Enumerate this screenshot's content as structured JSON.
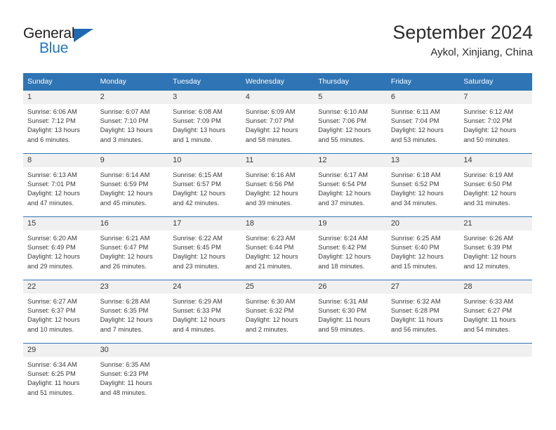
{
  "brand": {
    "name_part1": "General",
    "name_part2": "Blue",
    "flag_icon": "triangle-flag-icon"
  },
  "header": {
    "title": "September 2024",
    "subtitle": "Aykol, Xinjiang, China"
  },
  "calendar": {
    "weekday_headers": [
      "Sunday",
      "Monday",
      "Tuesday",
      "Wednesday",
      "Thursday",
      "Friday",
      "Saturday"
    ],
    "header_bg": "#2f75b5",
    "daynum_bg": "#f0f0f0",
    "weeks": [
      [
        {
          "day": "1",
          "sunrise": "Sunrise: 6:06 AM",
          "sunset": "Sunset: 7:12 PM",
          "daylight_line1": "Daylight: 13 hours",
          "daylight_line2": "and 6 minutes."
        },
        {
          "day": "2",
          "sunrise": "Sunrise: 6:07 AM",
          "sunset": "Sunset: 7:10 PM",
          "daylight_line1": "Daylight: 13 hours",
          "daylight_line2": "and 3 minutes."
        },
        {
          "day": "3",
          "sunrise": "Sunrise: 6:08 AM",
          "sunset": "Sunset: 7:09 PM",
          "daylight_line1": "Daylight: 13 hours",
          "daylight_line2": "and 1 minute."
        },
        {
          "day": "4",
          "sunrise": "Sunrise: 6:09 AM",
          "sunset": "Sunset: 7:07 PM",
          "daylight_line1": "Daylight: 12 hours",
          "daylight_line2": "and 58 minutes."
        },
        {
          "day": "5",
          "sunrise": "Sunrise: 6:10 AM",
          "sunset": "Sunset: 7:06 PM",
          "daylight_line1": "Daylight: 12 hours",
          "daylight_line2": "and 55 minutes."
        },
        {
          "day": "6",
          "sunrise": "Sunrise: 6:11 AM",
          "sunset": "Sunset: 7:04 PM",
          "daylight_line1": "Daylight: 12 hours",
          "daylight_line2": "and 53 minutes."
        },
        {
          "day": "7",
          "sunrise": "Sunrise: 6:12 AM",
          "sunset": "Sunset: 7:02 PM",
          "daylight_line1": "Daylight: 12 hours",
          "daylight_line2": "and 50 minutes."
        }
      ],
      [
        {
          "day": "8",
          "sunrise": "Sunrise: 6:13 AM",
          "sunset": "Sunset: 7:01 PM",
          "daylight_line1": "Daylight: 12 hours",
          "daylight_line2": "and 47 minutes."
        },
        {
          "day": "9",
          "sunrise": "Sunrise: 6:14 AM",
          "sunset": "Sunset: 6:59 PM",
          "daylight_line1": "Daylight: 12 hours",
          "daylight_line2": "and 45 minutes."
        },
        {
          "day": "10",
          "sunrise": "Sunrise: 6:15 AM",
          "sunset": "Sunset: 6:57 PM",
          "daylight_line1": "Daylight: 12 hours",
          "daylight_line2": "and 42 minutes."
        },
        {
          "day": "11",
          "sunrise": "Sunrise: 6:16 AM",
          "sunset": "Sunset: 6:56 PM",
          "daylight_line1": "Daylight: 12 hours",
          "daylight_line2": "and 39 minutes."
        },
        {
          "day": "12",
          "sunrise": "Sunrise: 6:17 AM",
          "sunset": "Sunset: 6:54 PM",
          "daylight_line1": "Daylight: 12 hours",
          "daylight_line2": "and 37 minutes."
        },
        {
          "day": "13",
          "sunrise": "Sunrise: 6:18 AM",
          "sunset": "Sunset: 6:52 PM",
          "daylight_line1": "Daylight: 12 hours",
          "daylight_line2": "and 34 minutes."
        },
        {
          "day": "14",
          "sunrise": "Sunrise: 6:19 AM",
          "sunset": "Sunset: 6:50 PM",
          "daylight_line1": "Daylight: 12 hours",
          "daylight_line2": "and 31 minutes."
        }
      ],
      [
        {
          "day": "15",
          "sunrise": "Sunrise: 6:20 AM",
          "sunset": "Sunset: 6:49 PM",
          "daylight_line1": "Daylight: 12 hours",
          "daylight_line2": "and 29 minutes."
        },
        {
          "day": "16",
          "sunrise": "Sunrise: 6:21 AM",
          "sunset": "Sunset: 6:47 PM",
          "daylight_line1": "Daylight: 12 hours",
          "daylight_line2": "and 26 minutes."
        },
        {
          "day": "17",
          "sunrise": "Sunrise: 6:22 AM",
          "sunset": "Sunset: 6:45 PM",
          "daylight_line1": "Daylight: 12 hours",
          "daylight_line2": "and 23 minutes."
        },
        {
          "day": "18",
          "sunrise": "Sunrise: 6:23 AM",
          "sunset": "Sunset: 6:44 PM",
          "daylight_line1": "Daylight: 12 hours",
          "daylight_line2": "and 21 minutes."
        },
        {
          "day": "19",
          "sunrise": "Sunrise: 6:24 AM",
          "sunset": "Sunset: 6:42 PM",
          "daylight_line1": "Daylight: 12 hours",
          "daylight_line2": "and 18 minutes."
        },
        {
          "day": "20",
          "sunrise": "Sunrise: 6:25 AM",
          "sunset": "Sunset: 6:40 PM",
          "daylight_line1": "Daylight: 12 hours",
          "daylight_line2": "and 15 minutes."
        },
        {
          "day": "21",
          "sunrise": "Sunrise: 6:26 AM",
          "sunset": "Sunset: 6:39 PM",
          "daylight_line1": "Daylight: 12 hours",
          "daylight_line2": "and 12 minutes."
        }
      ],
      [
        {
          "day": "22",
          "sunrise": "Sunrise: 6:27 AM",
          "sunset": "Sunset: 6:37 PM",
          "daylight_line1": "Daylight: 12 hours",
          "daylight_line2": "and 10 minutes."
        },
        {
          "day": "23",
          "sunrise": "Sunrise: 6:28 AM",
          "sunset": "Sunset: 6:35 PM",
          "daylight_line1": "Daylight: 12 hours",
          "daylight_line2": "and 7 minutes."
        },
        {
          "day": "24",
          "sunrise": "Sunrise: 6:29 AM",
          "sunset": "Sunset: 6:33 PM",
          "daylight_line1": "Daylight: 12 hours",
          "daylight_line2": "and 4 minutes."
        },
        {
          "day": "25",
          "sunrise": "Sunrise: 6:30 AM",
          "sunset": "Sunset: 6:32 PM",
          "daylight_line1": "Daylight: 12 hours",
          "daylight_line2": "and 2 minutes."
        },
        {
          "day": "26",
          "sunrise": "Sunrise: 6:31 AM",
          "sunset": "Sunset: 6:30 PM",
          "daylight_line1": "Daylight: 11 hours",
          "daylight_line2": "and 59 minutes."
        },
        {
          "day": "27",
          "sunrise": "Sunrise: 6:32 AM",
          "sunset": "Sunset: 6:28 PM",
          "daylight_line1": "Daylight: 11 hours",
          "daylight_line2": "and 56 minutes."
        },
        {
          "day": "28",
          "sunrise": "Sunrise: 6:33 AM",
          "sunset": "Sunset: 6:27 PM",
          "daylight_line1": "Daylight: 11 hours",
          "daylight_line2": "and 54 minutes."
        }
      ],
      [
        {
          "day": "29",
          "sunrise": "Sunrise: 6:34 AM",
          "sunset": "Sunset: 6:25 PM",
          "daylight_line1": "Daylight: 11 hours",
          "daylight_line2": "and 51 minutes."
        },
        {
          "day": "30",
          "sunrise": "Sunrise: 6:35 AM",
          "sunset": "Sunset: 6:23 PM",
          "daylight_line1": "Daylight: 11 hours",
          "daylight_line2": "and 48 minutes."
        },
        {
          "day": "",
          "sunrise": "",
          "sunset": "",
          "daylight_line1": "",
          "daylight_line2": ""
        },
        {
          "day": "",
          "sunrise": "",
          "sunset": "",
          "daylight_line1": "",
          "daylight_line2": ""
        },
        {
          "day": "",
          "sunrise": "",
          "sunset": "",
          "daylight_line1": "",
          "daylight_line2": ""
        },
        {
          "day": "",
          "sunrise": "",
          "sunset": "",
          "daylight_line1": "",
          "daylight_line2": ""
        },
        {
          "day": "",
          "sunrise": "",
          "sunset": "",
          "daylight_line1": "",
          "daylight_line2": ""
        }
      ]
    ]
  }
}
